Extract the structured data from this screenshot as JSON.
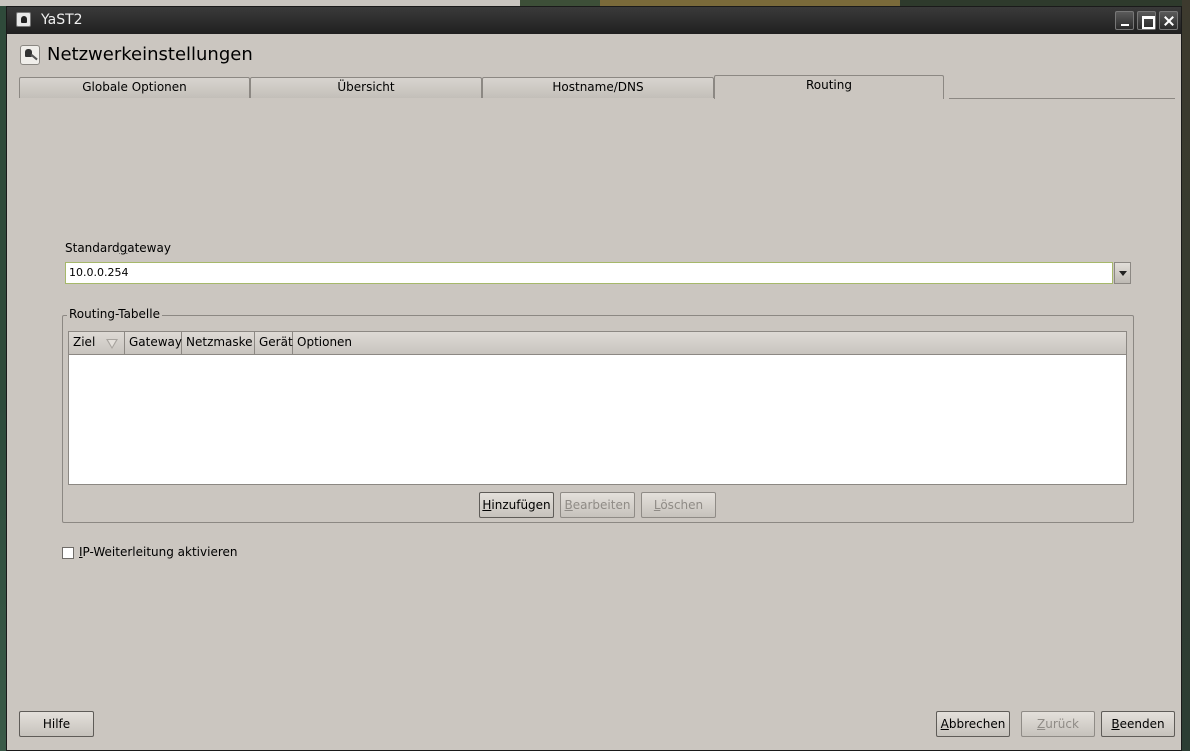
{
  "window": {
    "title": "YaST2"
  },
  "header": {
    "title": "Netzwerkeinstellungen"
  },
  "tabs": [
    {
      "label": "Globale Optionen",
      "active": false
    },
    {
      "label": "Übersicht",
      "active": false
    },
    {
      "label": "Hostname/DNS",
      "active": false
    },
    {
      "label": "Routing",
      "active": true
    }
  ],
  "gateway": {
    "label_pre": "Standard",
    "label_mnemonic": "g",
    "label_post": "ateway",
    "value": "10.0.0.254"
  },
  "routing_table": {
    "legend": "Routing-Tabelle",
    "columns": [
      "Ziel",
      "Gateway",
      "Netzmaske",
      "Gerät",
      "Optionen"
    ],
    "rows": [],
    "buttons": {
      "add": {
        "mnemonic": "H",
        "rest": "inzufügen"
      },
      "edit": {
        "mnemonic": "B",
        "rest": "earbeiten"
      },
      "delete": {
        "mnemonic": "L",
        "rest": "öschen"
      }
    }
  },
  "ip_forwarding": {
    "mnemonic": "I",
    "rest": "P-Weiterleitung aktivieren",
    "checked": false
  },
  "footer": {
    "help": "Hilfe",
    "cancel": {
      "mnemonic": "A",
      "rest": "bbrechen"
    },
    "back": {
      "mnemonic": "Z",
      "rest": "urück"
    },
    "finish": {
      "mnemonic": "B",
      "rest": "eenden"
    }
  }
}
